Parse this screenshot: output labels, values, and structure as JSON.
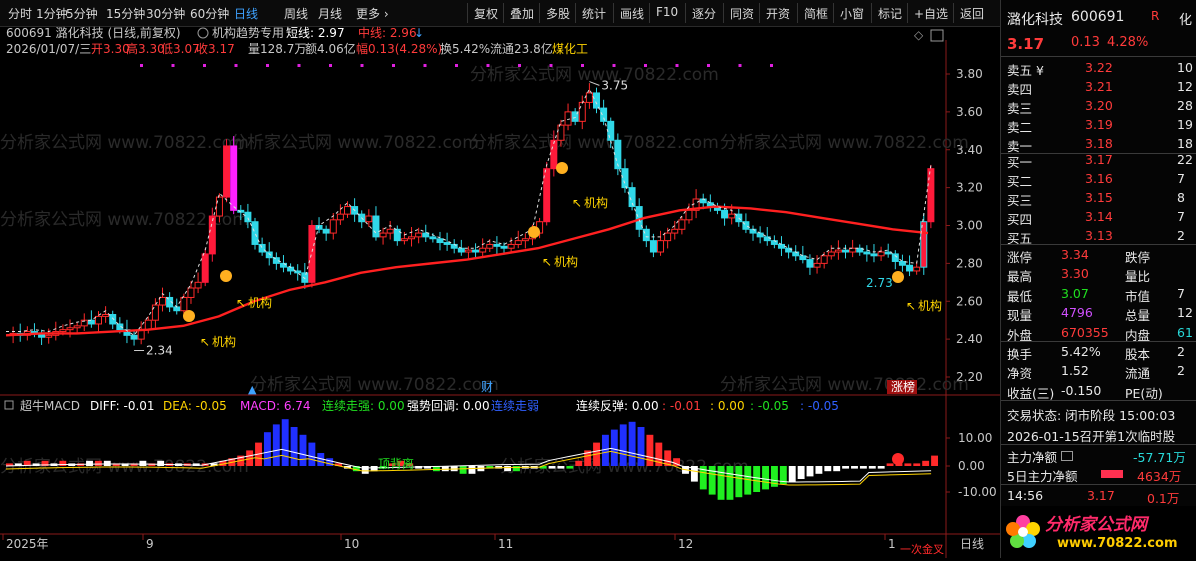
{
  "toolbar": {
    "periods": [
      "分时",
      "1分钟",
      "5分钟",
      "15分钟",
      "30分钟",
      "60分钟",
      "日线",
      "周线",
      "月线",
      "更多 ›"
    ],
    "active": "日线",
    "buttons": [
      "复权",
      "叠加",
      "多股",
      "统计",
      "画线",
      "F10",
      "逐分",
      "同资",
      "开资",
      "简框",
      "小窗",
      "标记",
      "+自选",
      "返回"
    ]
  },
  "header": {
    "line1_code": "600691 潞化科技 (日线,前复权)",
    "line1_indicator": "机构趋势专用",
    "line1_short": "短线: 2.97",
    "line1_mid": "中线: 2.96",
    "line1_arrow": "↓",
    "line2_date": "2026/01/07/三",
    "line2_open": "开3.30",
    "line2_high": "高3.30",
    "line2_low": "低3.07",
    "line2_close": "收3.17",
    "line2_vol": "量128.7万",
    "line2_amt": "额4.06亿",
    "line2_chg": "幅0.13(4.28%)",
    "line2_turn": "换5.42%",
    "line2_float": "流通23.8亿",
    "line2_sector": "煤化工"
  },
  "annotations": {
    "hi": "3.75",
    "lo": "2.34",
    "last_low": "2.73",
    "tag": "机构",
    "cai": "财",
    "zhangbang": "涨榜",
    "dingbeili": "顶背离",
    "bottom_note": "一次金叉"
  },
  "watermark": "分析家公式网 www.70822.com",
  "macd_header": {
    "name": "超牛MACD",
    "diff": "DIFF: -0.01",
    "dea": "DEA: -0.05",
    "macd": "MACD: 6.74",
    "lianxu_q": "连续走强: 0.00",
    "qiangshi": "强势回调: 0.00",
    "lianxu_d": "连续走弱",
    "fantan": "连续反弹: 0.00",
    "v1": ": -0.01",
    "v2": ": 0.00",
    "v3": ": -0.05",
    "v4": ": -0.05"
  },
  "x_labels": [
    "2025年",
    "9",
    "10",
    "11",
    "12",
    "1"
  ],
  "y_labels": [
    "3.80",
    "3.60",
    "3.40",
    "3.20",
    "3.00",
    "2.80",
    "2.60",
    "2.40",
    "2.20"
  ],
  "macd_y": [
    "10.00",
    "0.00",
    "-10.00"
  ],
  "bottom_right": "日线",
  "chart_data": {
    "type": "candlestick",
    "ylim": [
      2.15,
      3.85
    ],
    "hi": 3.75,
    "lo": 2.34,
    "last": {
      "open": 3.3,
      "high": 3.3,
      "low": 3.07,
      "close": 3.17
    }
  },
  "side": {
    "name": "潞化科技",
    "code": "600691",
    "flag": "化",
    "price": "3.17",
    "chg": "0.13",
    "pct": "4.28%",
    "asks": [
      [
        "卖五 ¥",
        "3.22",
        "10"
      ],
      [
        "卖四",
        "3.21",
        "12"
      ],
      [
        "卖三",
        "3.20",
        "28"
      ],
      [
        "卖二",
        "3.19",
        "19"
      ],
      [
        "卖一",
        "3.18",
        "18"
      ]
    ],
    "bids": [
      [
        "买一",
        "3.17",
        "22"
      ],
      [
        "买二",
        "3.16",
        "7"
      ],
      [
        "买三",
        "3.15",
        "8"
      ],
      [
        "买四",
        "3.14",
        "7"
      ],
      [
        "买五",
        "3.13",
        "2"
      ]
    ],
    "stats": [
      [
        "涨停",
        "3.34",
        "跌停",
        ""
      ],
      [
        "最高",
        "3.30",
        "量比",
        ""
      ],
      [
        "最低",
        "3.07",
        "市值",
        "7"
      ],
      [
        "现量",
        "4796",
        "总量",
        "12"
      ],
      [
        "外盘",
        "670355",
        "内盘",
        "61"
      ]
    ],
    "stats2": [
      [
        "换手",
        "5.42%",
        "股本",
        "2"
      ],
      [
        "净资",
        "1.52",
        "流通",
        "2"
      ],
      [
        "收益(三)",
        "-0.150",
        "PE(动)",
        ""
      ]
    ],
    "trade_status": "交易状态: 闭市阶段 15:00:03",
    "notice": "2026-01-15召开第1次临时股",
    "mainflow_label": "主力净额",
    "mainflow_val": "-57.71万",
    "flow5_label": "5日主力净额",
    "flow5_val": "4634万",
    "tick_time": "14:56",
    "tick_price": "3.17",
    "tick_vol": "0.1万",
    "brand": "分析家公式网",
    "brand_url": "www.70822.com"
  }
}
